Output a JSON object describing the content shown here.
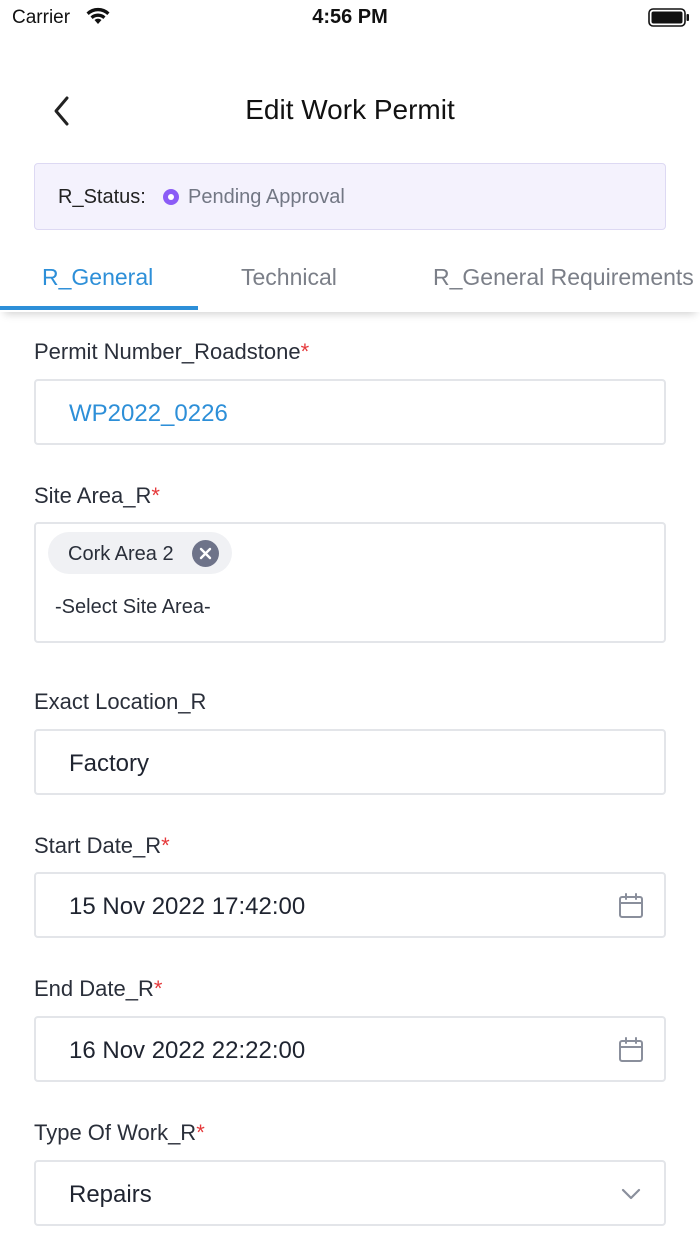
{
  "statusbar": {
    "carrier": "Carrier",
    "time": "4:56 PM"
  },
  "header": {
    "title": "Edit Work Permit",
    "back_icon": "chevron-left-icon"
  },
  "status": {
    "label": "R_Status:",
    "value": "Pending Approval",
    "color": "#8b5cf6"
  },
  "tabs": [
    {
      "label": "R_General",
      "active": true
    },
    {
      "label": "Technical",
      "active": false
    },
    {
      "label": "R_General Requirements",
      "active": false
    }
  ],
  "form": {
    "required_mark": "*",
    "permit_number": {
      "label": "Permit Number_Roadstone",
      "value": "WP2022_0226"
    },
    "site_area": {
      "label": "Site Area_R",
      "chip": "Cork Area 2",
      "placeholder": "-Select Site Area-"
    },
    "exact_location": {
      "label": "Exact Location_R",
      "value": "Factory"
    },
    "start_date": {
      "label": "Start Date_R",
      "value": "15 Nov 2022 17:42:00"
    },
    "end_date": {
      "label": "End Date_R",
      "value": "16 Nov 2022 22:22:00"
    },
    "type_of_work": {
      "label": "Type Of Work_R",
      "value": "Repairs"
    }
  },
  "colors": {
    "accent": "#2d8fd8",
    "required": "#e5393b",
    "banner_bg": "#f4f2fd"
  }
}
